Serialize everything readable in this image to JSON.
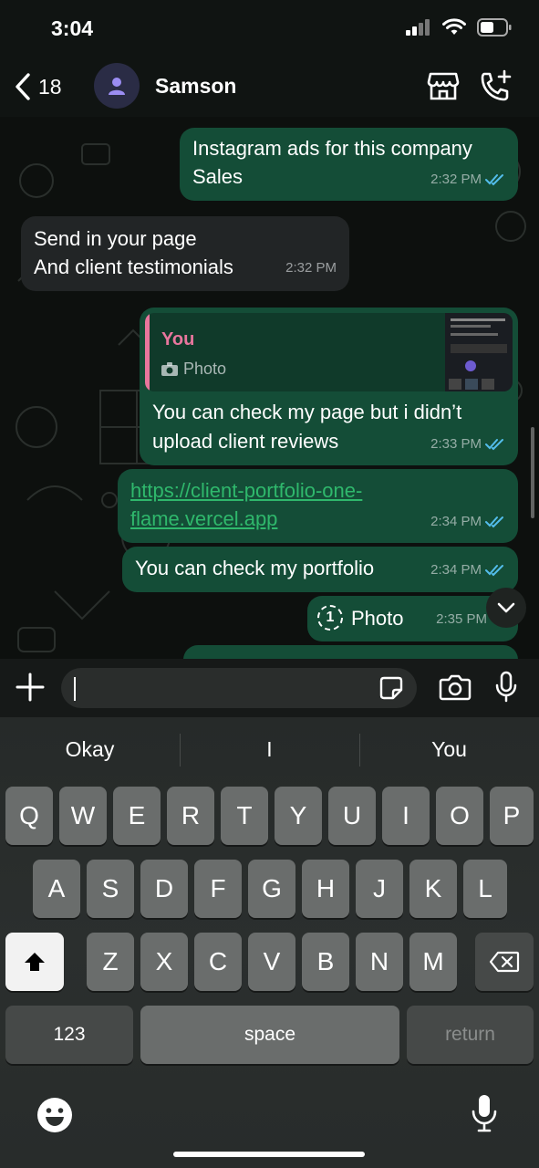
{
  "status": {
    "time": "3:04",
    "icons": [
      "signal-icon",
      "wifi-icon",
      "battery-icon"
    ]
  },
  "header": {
    "back_count": "18",
    "contact_name": "Samson",
    "icons": [
      "back-chevron-icon",
      "person-icon",
      "shop-icon",
      "add-call-icon"
    ]
  },
  "messages": [
    {
      "dir": "out",
      "text": "Instagram ads for this company\nSales",
      "time": "2:32 PM"
    },
    {
      "dir": "in",
      "text": "Send in your page\nAnd client testimonials",
      "time": "2:32 PM"
    },
    {
      "dir": "out",
      "quote_author": "You",
      "quote_type": "Photo",
      "text": "You can check my page but i didn’t upload client reviews",
      "time": "2:33 PM"
    },
    {
      "dir": "out",
      "link": "https://client-portfolio-one-flame.vercel.app",
      "link_line1": "https://client-portfolio-one-",
      "link_line2": "flame.vercel.app",
      "time": "2:34 PM"
    },
    {
      "dir": "out",
      "text": "You can check my portfolio",
      "time": "2:34 PM"
    },
    {
      "dir": "out",
      "view_once_label": "Photo",
      "view_once_digit": "1",
      "time": "2:35 PM"
    }
  ],
  "input": {
    "placeholder": ""
  },
  "keyboard": {
    "suggestions": [
      "Okay",
      "I",
      "You"
    ],
    "row1": [
      "Q",
      "W",
      "E",
      "R",
      "T",
      "Y",
      "U",
      "I",
      "O",
      "P"
    ],
    "row2": [
      "A",
      "S",
      "D",
      "F",
      "G",
      "H",
      "J",
      "K",
      "L"
    ],
    "row3": [
      "Z",
      "X",
      "C",
      "V",
      "B",
      "N",
      "M"
    ],
    "numbers_label": "123",
    "space_label": "space",
    "return_label": "return"
  },
  "colors": {
    "outgoing": "#144d37",
    "incoming": "#222526",
    "link": "#2fb86c",
    "quote_accent": "#e8769d",
    "tick_read": "#53bdeb"
  }
}
